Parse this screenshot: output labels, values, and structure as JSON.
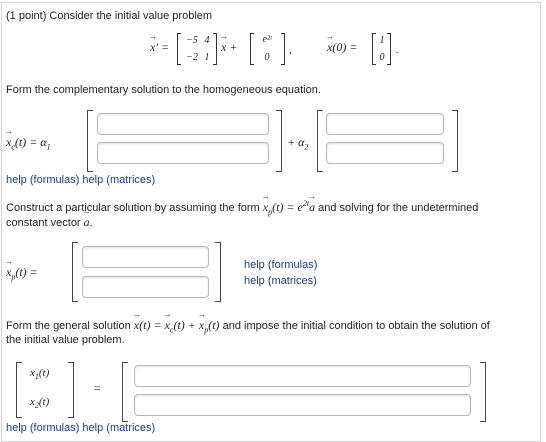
{
  "problem": {
    "intro": "(1 point) Consider the initial value problem",
    "equation": {
      "lhs": "x′ =",
      "matrix": [
        [
          "−5",
          "4"
        ],
        [
          "−2",
          "1"
        ]
      ],
      "plus": "x +",
      "forcing": [
        "e²ᵗ",
        "0"
      ],
      "ic_label": "x(0) =",
      "ic": [
        "1",
        "0"
      ]
    }
  },
  "part1": {
    "instruction": "Form the complementary solution to the homogeneous equation.",
    "lhs": "x_c(t) = α₁",
    "plus_alpha": "+ α₂",
    "help_formulas": "help (formulas)",
    "help_matrices": "help (matrices)",
    "inputs": [
      "",
      "",
      "",
      ""
    ]
  },
  "part2": {
    "instruction_line1": "Construct a particular solution by assuming the form x_p(t) = e²ᵗa and solving for the undetermined",
    "instruction_line2": "constant vector a.",
    "lhs": "x_p(t) =",
    "help_formulas": "help (formulas)",
    "help_matrices": "help (matrices)",
    "inputs": [
      "",
      ""
    ]
  },
  "part3": {
    "instruction_line1": "Form the general solution x(t) = x_c(t) + x_p(t) and impose the initial condition to obtain the solution of",
    "instruction_line2": "the initial value problem.",
    "vec_labels": [
      "x₁(t)",
      "x₂(t)"
    ],
    "equals": "=",
    "help_formulas": "help (formulas)",
    "help_matrices": "help (matrices)",
    "inputs": [
      "",
      ""
    ]
  }
}
